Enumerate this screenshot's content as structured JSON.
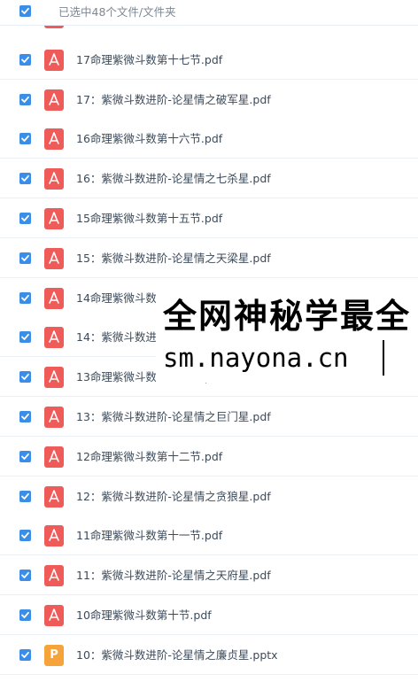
{
  "header": {
    "selected_text": "已选中48个文件/文件夹"
  },
  "files": [
    {
      "name": "17命理紫微斗数第十七节.pdf",
      "type": "pdf"
    },
    {
      "name": "17：紫微斗数进阶-论星情之破军星.pdf",
      "type": "pdf"
    },
    {
      "name": "16命理紫微斗数第十六节.pdf",
      "type": "pdf"
    },
    {
      "name": "16：紫微斗数进阶-论星情之七杀星.pdf",
      "type": "pdf"
    },
    {
      "name": "15命理紫微斗数第十五节.pdf",
      "type": "pdf"
    },
    {
      "name": "15：紫微斗数进阶-论星情之天梁星.pdf",
      "type": "pdf"
    },
    {
      "name": "14命理紫微斗数第十四节.pdf",
      "type": "pdf"
    },
    {
      "name": "14：紫微斗数进阶-论星情之天相星.pdf",
      "type": "pdf"
    },
    {
      "name": "13命理紫微斗数第十三节.pdf",
      "type": "pdf"
    },
    {
      "name": "13：紫微斗数进阶-论星情之巨门星.pdf",
      "type": "pdf"
    },
    {
      "name": "12命理紫微斗数第十二节.pdf",
      "type": "pdf"
    },
    {
      "name": "12：紫微斗数进阶-论星情之贪狼星.pdf",
      "type": "pdf"
    },
    {
      "name": "11命理紫微斗数第十一节.pdf",
      "type": "pdf"
    },
    {
      "name": "11：紫微斗数进阶-论星情之天府星.pdf",
      "type": "pdf"
    },
    {
      "name": "10命理紫微斗数第十节.pdf",
      "type": "pdf"
    },
    {
      "name": "10：紫微斗数进阶-论星情之廉贞星.pptx",
      "type": "pptx"
    }
  ],
  "icons": {
    "checkbox": "checked-checkbox-icon",
    "pdf": "pdf-file-icon",
    "pptx": "pptx-file-icon",
    "pptx_letter": "P"
  },
  "colors": {
    "checkbox": "#3b8ee8",
    "pdf": "#ef5b59",
    "pptx": "#f6a43a"
  },
  "watermark": {
    "line1": "全网神秘学最全",
    "line2": "sm.nayona.cn"
  }
}
